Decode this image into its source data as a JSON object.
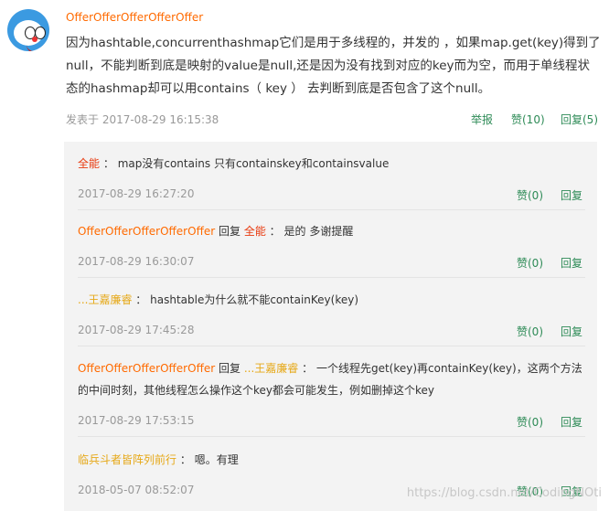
{
  "main": {
    "author": "OfferOfferOfferOfferOffer",
    "content": "因为hashtable,concurrenthashmap它们是用于多线程的，并发的 ，如果map.get(key)得到了null，不能判断到底是映射的value是null,还是因为没有找到对应的key而为空，而用于单线程状态的hashmap却可以用contains（ key ） 去判断到底是否包含了这个null。",
    "date": "发表于 2017-08-29 16:15:38",
    "report": "举报",
    "like": "赞(10)",
    "reply": "回复(5)"
  },
  "replies": [
    {
      "nick": "全能",
      "separator": "：",
      "text": "map没有contains 只有containskey和containsvalue",
      "date": "2017-08-29 16:27:20",
      "like": "赞(0)",
      "reply": "回复"
    },
    {
      "nick": "OfferOfferOfferOfferOffer",
      "reply_word": "回复",
      "target": "全能",
      "separator": "：",
      "text": "是的 多谢提醒",
      "date": "2017-08-29 16:30:07",
      "like": "赞(0)",
      "reply": "回复"
    },
    {
      "nick": "...王嘉廉睿",
      "separator": "：",
      "text": "hashtable为什么就不能containKey(key)",
      "date": "2017-08-29 17:45:28",
      "like": "赞(0)",
      "reply": "回复"
    },
    {
      "nick": "OfferOfferOfferOfferOffer",
      "reply_word": "回复",
      "target": "...王嘉廉睿",
      "separator": "：",
      "text": "一个线程先get(key)再containKey(key)，这两个方法的中间时刻，其他线程怎么操作这个key都会可能发生，例如删掉这个key",
      "date": "2017-08-29 17:53:15",
      "like": "赞(0)",
      "reply": "回复"
    },
    {
      "nick": "临兵斗者皆阵列前行",
      "separator": "：",
      "text": "嗯。有理",
      "date": "2018-05-07 08:52:07",
      "like": "赞(0)",
      "reply": "回复"
    }
  ],
  "watermark": "https://blog.csdn.net/CodingNOti",
  "colors": {
    "accent_green": "#2e8b57",
    "nick_orange": "#ff6a00",
    "nick_red": "#e8390e",
    "nick_gold": "#e6a817",
    "reply_bg": "#f3f3f3"
  }
}
